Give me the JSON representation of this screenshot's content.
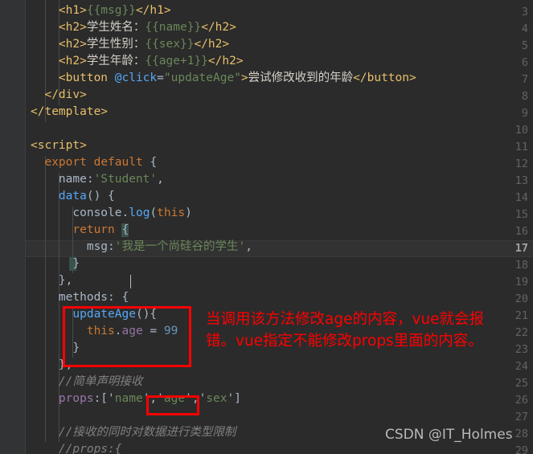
{
  "editor": {
    "theme_background": "#2b2b2b",
    "gutter_background": "#313335",
    "current_line_background": "#323232",
    "accent_annotation_color": "#ff0000",
    "first_visible_line": 3,
    "current_line": 17,
    "language": "vue"
  },
  "lines": [
    {
      "num": "3",
      "indent": 4,
      "text": "<h1>{{msg}}</h1>"
    },
    {
      "num": "4",
      "indent": 4,
      "text": "<h2>学生姓名：{{name}}</h2>"
    },
    {
      "num": "5",
      "indent": 4,
      "text": "<h2>学生性别：{{sex}}</h2>"
    },
    {
      "num": "6",
      "indent": 4,
      "text": "<h2>学生年龄：{{age+1}}</h2>"
    },
    {
      "num": "7",
      "indent": 4,
      "text": "<button @click=\"updateAge\">尝试修改收到的年龄</button>"
    },
    {
      "num": "8",
      "indent": 2,
      "text": "</div>"
    },
    {
      "num": "9",
      "indent": 0,
      "text": "</template>"
    },
    {
      "num": "10",
      "indent": 0,
      "text": ""
    },
    {
      "num": "11",
      "indent": 0,
      "text": "<script>"
    },
    {
      "num": "12",
      "indent": 2,
      "text": "export default {"
    },
    {
      "num": "13",
      "indent": 4,
      "text": "name:'Student',"
    },
    {
      "num": "14",
      "indent": 4,
      "text": "data() {"
    },
    {
      "num": "15",
      "indent": 6,
      "text": "console.log(this)"
    },
    {
      "num": "16",
      "indent": 6,
      "text": "return {"
    },
    {
      "num": "17",
      "indent": 8,
      "text": "msg:'我是一个尚硅谷的学生',"
    },
    {
      "num": "18",
      "indent": 6,
      "text": "}"
    },
    {
      "num": "19",
      "indent": 4,
      "text": "},"
    },
    {
      "num": "20",
      "indent": 4,
      "text": "methods: {"
    },
    {
      "num": "21",
      "indent": 6,
      "text": "updateAge(){"
    },
    {
      "num": "22",
      "indent": 8,
      "text": "this.age = 99"
    },
    {
      "num": "23",
      "indent": 6,
      "text": "}"
    },
    {
      "num": "24",
      "indent": 4,
      "text": "},"
    },
    {
      "num": "25",
      "indent": 4,
      "text": "//简单声明接收"
    },
    {
      "num": "26",
      "indent": 4,
      "text": "props:['name','age','sex']"
    },
    {
      "num": "27",
      "indent": 0,
      "text": ""
    },
    {
      "num": "28",
      "indent": 4,
      "text": "//接收的同时对数据进行类型限制"
    },
    {
      "num": "29",
      "indent": 4,
      "text": "//props:{"
    }
  ],
  "annotations": {
    "note_line1": "当调用该方法修改age的内容，vue就会报",
    "note_line2": "错。vue指定不能修改props里面的内容。",
    "highlight_box_methods_label": "updateAge-method-body",
    "highlight_box_props_label": "age-prop-entry"
  },
  "watermark": {
    "text": "CSDN @IT_Holmes"
  },
  "code_tokens": {
    "l3": [
      [
        "t-tag",
        "<h1>"
      ],
      [
        "t-mustache",
        "{{msg}}"
      ],
      [
        "t-tag",
        "</h1>"
      ]
    ],
    "l4": [
      [
        "t-tag",
        "<h2>"
      ],
      [
        "t-cjk",
        "学生姓名："
      ],
      [
        "t-mustache",
        "{{name}}"
      ],
      [
        "t-tag",
        "</h2>"
      ]
    ],
    "l5": [
      [
        "t-tag",
        "<h2>"
      ],
      [
        "t-cjk",
        "学生性别："
      ],
      [
        "t-mustache",
        "{{sex}}"
      ],
      [
        "t-tag",
        "</h2>"
      ]
    ],
    "l6": [
      [
        "t-tag",
        "<h2>"
      ],
      [
        "t-cjk",
        "学生年龄："
      ],
      [
        "t-mustache",
        "{{age+1}}"
      ],
      [
        "t-tag",
        "</h2>"
      ]
    ],
    "l7": [
      [
        "t-tag",
        "<button"
      ],
      [
        "t-white",
        " "
      ],
      [
        "t-method",
        "@click"
      ],
      [
        "t-punct",
        "="
      ],
      [
        "t-str",
        "\"updateAge\""
      ],
      [
        "t-tag",
        ">"
      ],
      [
        "t-cjk",
        "尝试修改收到的年龄"
      ],
      [
        "t-tag",
        "</button>"
      ]
    ],
    "l8": [
      [
        "t-tag",
        "</div>"
      ]
    ],
    "l9": [
      [
        "t-tag",
        "</template>"
      ]
    ],
    "l11": [
      [
        "t-tag",
        "<script>"
      ]
    ],
    "l12": [
      [
        "t-kw",
        "export"
      ],
      [
        "t-white",
        " "
      ],
      [
        "t-kw",
        "default"
      ],
      [
        "t-white",
        " "
      ],
      [
        "t-punct",
        "{"
      ]
    ],
    "l13": [
      [
        "t-objkey",
        "name"
      ],
      [
        "t-punct",
        ":"
      ],
      [
        "t-str",
        "'Student'"
      ],
      [
        "t-punct",
        ","
      ]
    ],
    "l14": [
      [
        "t-data",
        "data"
      ],
      [
        "t-punct",
        "() {"
      ]
    ],
    "l15": [
      [
        "t-ident",
        "console"
      ],
      [
        "t-punct",
        "."
      ],
      [
        "t-method",
        "log"
      ],
      [
        "t-punct",
        "("
      ],
      [
        "t-kw",
        "this"
      ],
      [
        "t-punct",
        ")"
      ]
    ],
    "l16": [
      [
        "t-kw",
        "return"
      ],
      [
        "t-white",
        " "
      ],
      [
        "t-punct",
        "{"
      ]
    ],
    "l17": [
      [
        "t-objkey",
        "msg"
      ],
      [
        "t-punct",
        ":"
      ],
      [
        "t-str",
        "'我是一个尚硅谷的学生'"
      ],
      [
        "t-punct",
        ","
      ]
    ],
    "l18": [
      [
        "t-punct",
        "}"
      ]
    ],
    "l19": [
      [
        "t-punct",
        "},"
      ]
    ],
    "l20": [
      [
        "t-objkey",
        "methods"
      ],
      [
        "t-punct",
        ": {"
      ]
    ],
    "l21": [
      [
        "t-method",
        "updateAge"
      ],
      [
        "t-punct",
        "(){"
      ]
    ],
    "l22": [
      [
        "t-kw",
        "this"
      ],
      [
        "t-punct",
        "."
      ],
      [
        "t-field",
        "age"
      ],
      [
        "t-punct",
        " = "
      ],
      [
        "t-num",
        "99"
      ]
    ],
    "l23": [
      [
        "t-punct",
        "}"
      ]
    ],
    "l24": [
      [
        "t-punct",
        "},"
      ]
    ],
    "l25": [
      [
        "t-comment",
        "//简单声明接收"
      ]
    ],
    "l26": [
      [
        "t-prop",
        "props"
      ],
      [
        "t-punct",
        ":['"
      ],
      [
        "t-str",
        "name"
      ],
      [
        "t-punct",
        "','"
      ],
      [
        "t-str",
        "age"
      ],
      [
        "t-punct",
        "','"
      ],
      [
        "t-str",
        "sex"
      ],
      [
        "t-punct",
        "']"
      ]
    ],
    "l28": [
      [
        "t-comment",
        "//接收的同时对数据进行类型限制"
      ]
    ],
    "l29": [
      [
        "t-comment",
        "//props:{"
      ]
    ]
  }
}
